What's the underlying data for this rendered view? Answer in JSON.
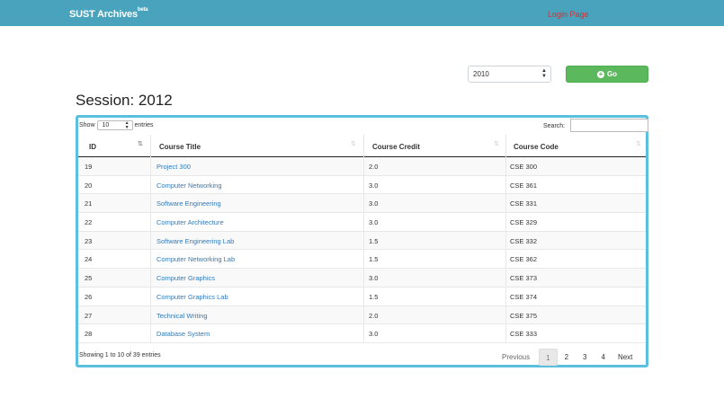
{
  "navbar": {
    "brand": "SUST Archives",
    "brand_sup": "beta",
    "login": "Login Page"
  },
  "filter": {
    "year_value": "2010",
    "go_label": "Go"
  },
  "session_title": "Session: 2012",
  "table_controls": {
    "show_label": "Show",
    "length_value": "10",
    "entries_label": "entries",
    "search_label": "Search:"
  },
  "table": {
    "headers": [
      "ID",
      "Course Title",
      "Course Credit",
      "Course Code"
    ],
    "rows": [
      {
        "id": "19",
        "title": "Project 300",
        "credit": "2.0",
        "code": "CSE 300"
      },
      {
        "id": "20",
        "title": "Computer Networking",
        "credit": "3.0",
        "code": "CSE 361"
      },
      {
        "id": "21",
        "title": "Software Engineering",
        "credit": "3.0",
        "code": "CSE 331"
      },
      {
        "id": "22",
        "title": "Computer Architecture",
        "credit": "3.0",
        "code": "CSE 329"
      },
      {
        "id": "23",
        "title": "Software Engineering Lab",
        "credit": "1.5",
        "code": "CSE 332"
      },
      {
        "id": "24",
        "title": "Computer Networking Lab",
        "credit": "1.5",
        "code": "CSE 362"
      },
      {
        "id": "25",
        "title": "Computer Graphics",
        "credit": "3.0",
        "code": "CSE 373"
      },
      {
        "id": "26",
        "title": "Computer Graphics Lab",
        "credit": "1.5",
        "code": "CSE 374"
      },
      {
        "id": "27",
        "title": "Technical Writing",
        "credit": "2.0",
        "code": "CSE 375"
      },
      {
        "id": "28",
        "title": "Database System",
        "credit": "3.0",
        "code": "CSE 333"
      }
    ]
  },
  "info": "Showing 1 to 10 of 39 entries",
  "pagination": {
    "previous": "Previous",
    "pages": [
      "1",
      "2",
      "3",
      "4"
    ],
    "current": "1",
    "next": "Next"
  }
}
